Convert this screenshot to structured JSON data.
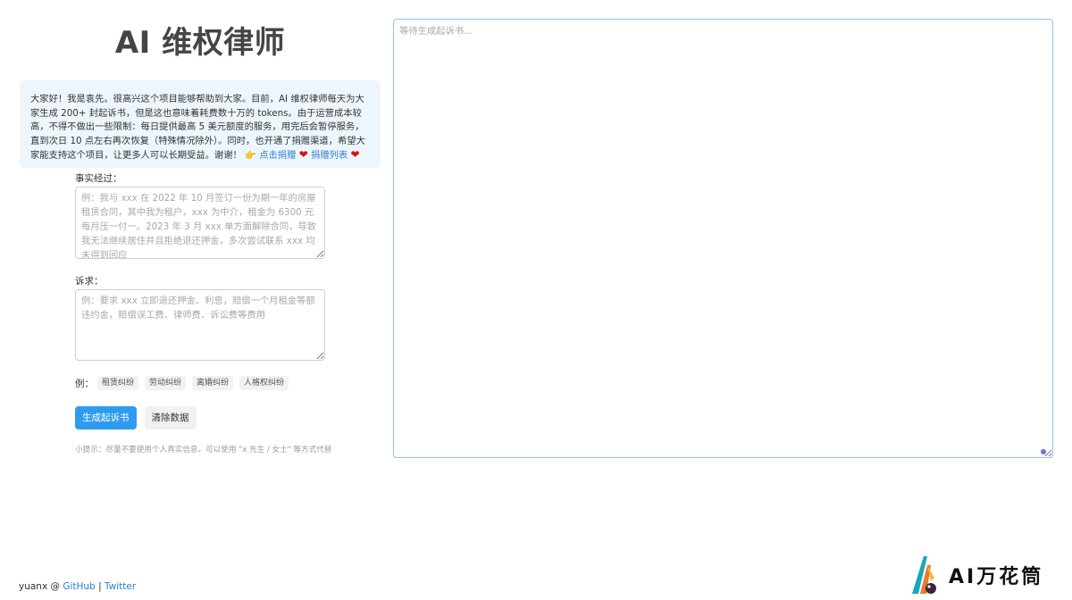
{
  "header": {
    "title": "AI 维权律师"
  },
  "notice": {
    "text": "大家好！我是袁先。很高兴这个项目能够帮助到大家。目前，AI 维权律师每天为大家生成 200+ 封起诉书，但是这也意味着耗费数十万的 tokens。由于运营成本较高，不得不做出一些限制：每日提供最高 5 美元额度的服务，用完后会暂停服务，直到次日 10 点左右再次恢复（特殊情况除外）。同时，也开通了捐赠渠道，希望大家能支持这个项目，让更多人可以长期受益。谢谢！",
    "donate_link": "点击捐赠",
    "donors_link": "捐赠列表",
    "pointer_icon": "👉",
    "heart_icon": "❤"
  },
  "form": {
    "facts_label": "事实经过：",
    "facts_placeholder": "例：我与 xxx 在 2022 年 10 月签订一份为期一年的房屋租赁合同，其中我为租户，xxx 为中介，租金为 6300 元每月压一付一。2023 年 3 月 xxx 单方面解除合同，导致我无法继续居住并且拒绝退还押金，多次尝试联系 xxx 均未得到回应",
    "claims_label": "诉求：",
    "claims_placeholder": "例：要求 xxx 立即退还押金、利息，赔偿一个月租金等额违约金，赔偿误工费、律师费、诉讼费等费用",
    "examples_label": "例：",
    "examples": [
      "租赁纠纷",
      "劳动纠纷",
      "离婚纠纷",
      "人格权纠纷"
    ],
    "generate_button": "生成起诉书",
    "clear_button": "清除数据",
    "hint": "小提示：尽量不要使用个人真实信息，可以使用 \"x 先生 / 女士\" 等方式代替"
  },
  "output": {
    "placeholder": "等待生成起诉书..."
  },
  "footer": {
    "author": "yuanx @ ",
    "github": "GitHub",
    "separator": " | ",
    "twitter": "Twitter"
  },
  "watermark": {
    "text": "AI万花筒"
  },
  "colors": {
    "primary": "#2d9bf0",
    "link": "#2f7fd3",
    "notice_bg": "#eef6fd",
    "output_border": "#8dc3ea"
  }
}
